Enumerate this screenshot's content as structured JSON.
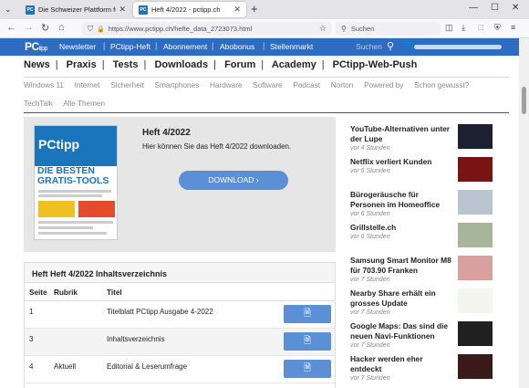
{
  "browser": {
    "tabs": [
      {
        "title": "Die Schweizer Plattform für Co",
        "active": false
      },
      {
        "title": "Heft 4/2022 - pctipp.ch",
        "active": true
      }
    ],
    "url": "https://www.pctipp.ch/hefte_data_2723073.html",
    "search_placeholder": "Suchen"
  },
  "site": {
    "logo": "PC",
    "logo_sub": "tipp",
    "header_nav": [
      "Newsletter",
      "PCtipp-Heft",
      "Abonnement",
      "Abobonus",
      "Stellenmarkt"
    ],
    "search_label": "Suchen",
    "main_nav": [
      "News",
      "Praxis",
      "Tests",
      "Downloads",
      "Forum",
      "Academy",
      "PCtipp-Web-Push"
    ],
    "sub_nav_row1": [
      "Windows 11",
      "Internet",
      "Sicherheit",
      "Smartphones",
      "Hardware",
      "Software",
      "Podcast",
      "Norton",
      "Powered by",
      "Schon gewusst?"
    ],
    "sub_nav_row2": [
      "TechTalk",
      "Alle Themen"
    ]
  },
  "download": {
    "title": "Heft 4/2022",
    "text": "Hier können Sie das Heft 4/2022 downloaden.",
    "button": "DOWNLOAD",
    "cover_logo": "PCtipp",
    "cover_headline": "DIE BESTEN GRATIS-TOOLS"
  },
  "toc": {
    "heading": "Heft Heft 4/2022 Inhaltsverzeichnis",
    "columns": [
      "Seite",
      "Rubrik",
      "Titel"
    ],
    "rows": [
      {
        "seite": "1",
        "rubrik": "",
        "titel": "Titelblatt PCtipp Ausgabe 4-2022"
      },
      {
        "seite": "3",
        "rubrik": "",
        "titel": "Inhaltsverzeichnis"
      },
      {
        "seite": "4",
        "rubrik": "Aktuell",
        "titel": "Editorial & Leserumfrage"
      }
    ]
  },
  "news": [
    {
      "title": "YouTube-Alternativen unter der Lupe",
      "time": "vor 4 Stunden",
      "thumb_color": "#1c2030"
    },
    {
      "title": "Netflix verliert Kunden",
      "time": "vor 5 Stunden",
      "thumb_color": "#7a1414"
    },
    {
      "title": "Bürogeräusche für Personen im Homeoffice",
      "time": "vor 6 Stunden",
      "thumb_color": "#b9c4cf"
    },
    {
      "title": "Grillstelle.ch",
      "time": "vor 6 Stunden",
      "thumb_color": "#a7b69a"
    },
    {
      "title": "Samsung Smart Monitor M8 für 703.90 Franken",
      "time": "vor 7 Stunden",
      "thumb_color": "#d9a0a0"
    },
    {
      "title": "Nearby Share erhält ein grosses Update",
      "time": "vor 7 Stunden",
      "thumb_color": "#f2f6ee"
    },
    {
      "title": "Google Maps: Das sind die neuen Navi-Funktionen",
      "time": "vor 7 Stunden",
      "thumb_color": "#202020"
    },
    {
      "title": "Hacker werden eher entdeckt",
      "time": "vor 7 Stunden",
      "thumb_color": "#3a1a1a"
    }
  ],
  "colors": {
    "brand": "#2e6cc2",
    "button": "#5b8fd6"
  }
}
